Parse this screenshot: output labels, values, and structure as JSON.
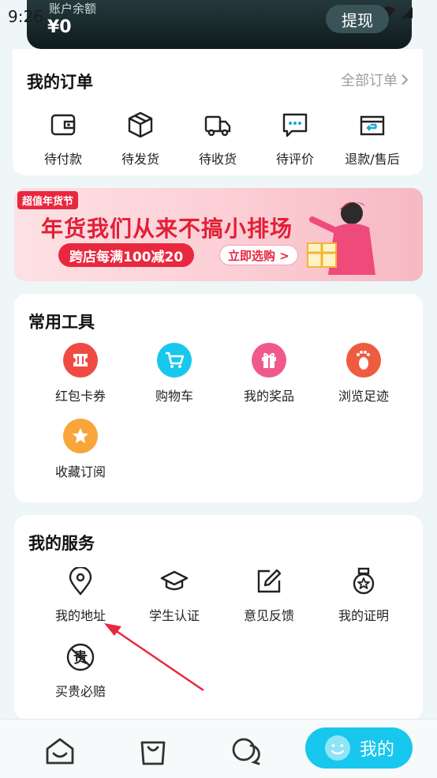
{
  "status": {
    "time": "9:26"
  },
  "header": {
    "balance_label": "账户余额",
    "balance_value": "¥0",
    "withdraw_label": "提现"
  },
  "orders": {
    "title": "我的订单",
    "all_label": "全部订单",
    "items": [
      {
        "label": "待付款",
        "icon": "wallet-icon"
      },
      {
        "label": "待发货",
        "icon": "box-icon"
      },
      {
        "label": "待收货",
        "icon": "truck-icon"
      },
      {
        "label": "待评价",
        "icon": "chat-bubble-icon"
      },
      {
        "label": "退款/售后",
        "icon": "refund-icon"
      }
    ]
  },
  "banner": {
    "tag": "超值年货节",
    "headline": "年货我们从来不搞小排场",
    "pill": "跨店每满100减20",
    "cta": "立即选购 >"
  },
  "tools": {
    "title": "常用工具",
    "items": [
      {
        "label": "红包卡券",
        "icon": "coupon-icon",
        "color": "#ef4b43"
      },
      {
        "label": "购物车",
        "icon": "cart-icon",
        "color": "#18c7ee"
      },
      {
        "label": "我的奖品",
        "icon": "gift-icon",
        "color": "#f05a8a"
      },
      {
        "label": "浏览足迹",
        "icon": "footprint-icon",
        "color": "#ef5b3f"
      },
      {
        "label": "收藏订阅",
        "icon": "star-icon",
        "color": "#f8a53a"
      }
    ]
  },
  "services": {
    "title": "我的服务",
    "items": [
      {
        "label": "我的地址",
        "icon": "location-pin-icon"
      },
      {
        "label": "学生认证",
        "icon": "graduation-cap-icon"
      },
      {
        "label": "意见反馈",
        "icon": "edit-icon"
      },
      {
        "label": "我的证明",
        "icon": "medal-icon"
      },
      {
        "label": "买贵必赔",
        "icon": "price-guarantee-icon"
      }
    ],
    "guarantee_glyph": "贵"
  },
  "tabbar": {
    "active_label": "我的",
    "tabs": [
      "home-icon",
      "bag-icon",
      "messages-icon",
      "profile-icon"
    ],
    "accent": "#18c7ee"
  }
}
